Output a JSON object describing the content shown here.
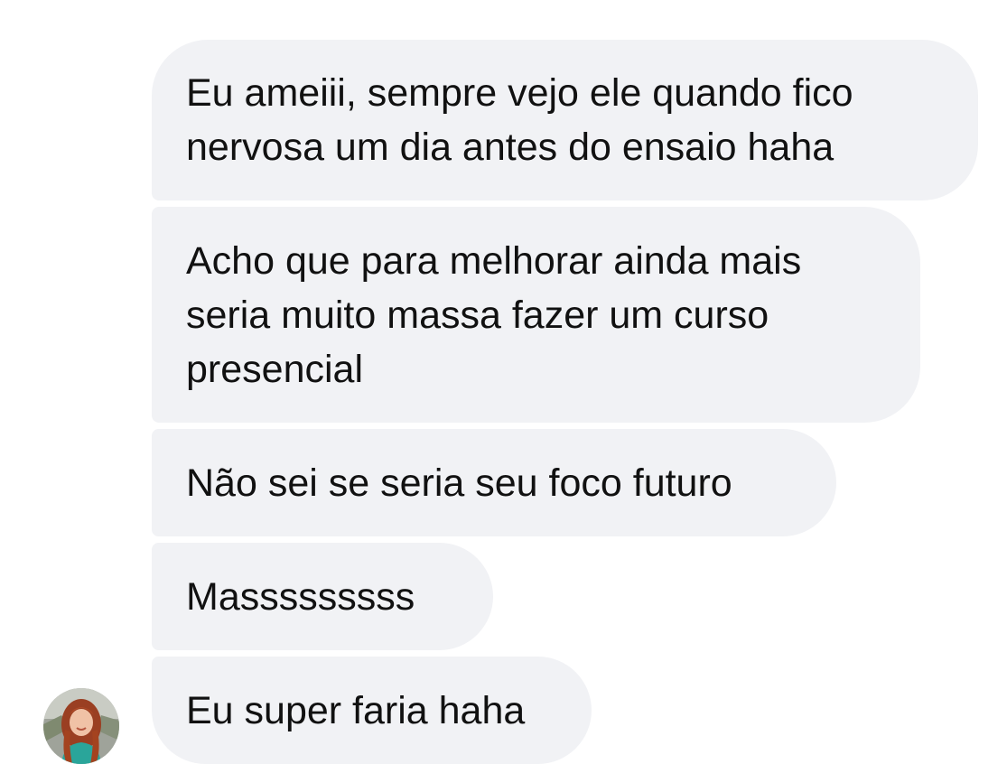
{
  "conversation": {
    "messages": [
      {
        "text": "Eu ameiii, sempre vejo ele quando fico\nnervosa um dia antes do ensaio haha"
      },
      {
        "text": "Acho que para melhorar ainda mais\nseria muito massa fazer um curso\npresencial"
      },
      {
        "text": "Não sei se seria seu foco futuro"
      },
      {
        "text": "Masssssssss"
      },
      {
        "text": "Eu super faria haha"
      }
    ],
    "sender_avatar": {
      "icon": "user-avatar-photo"
    },
    "colors": {
      "bubble_background": "#f1f2f5",
      "text": "#111111",
      "page_background": "#ffffff"
    }
  }
}
